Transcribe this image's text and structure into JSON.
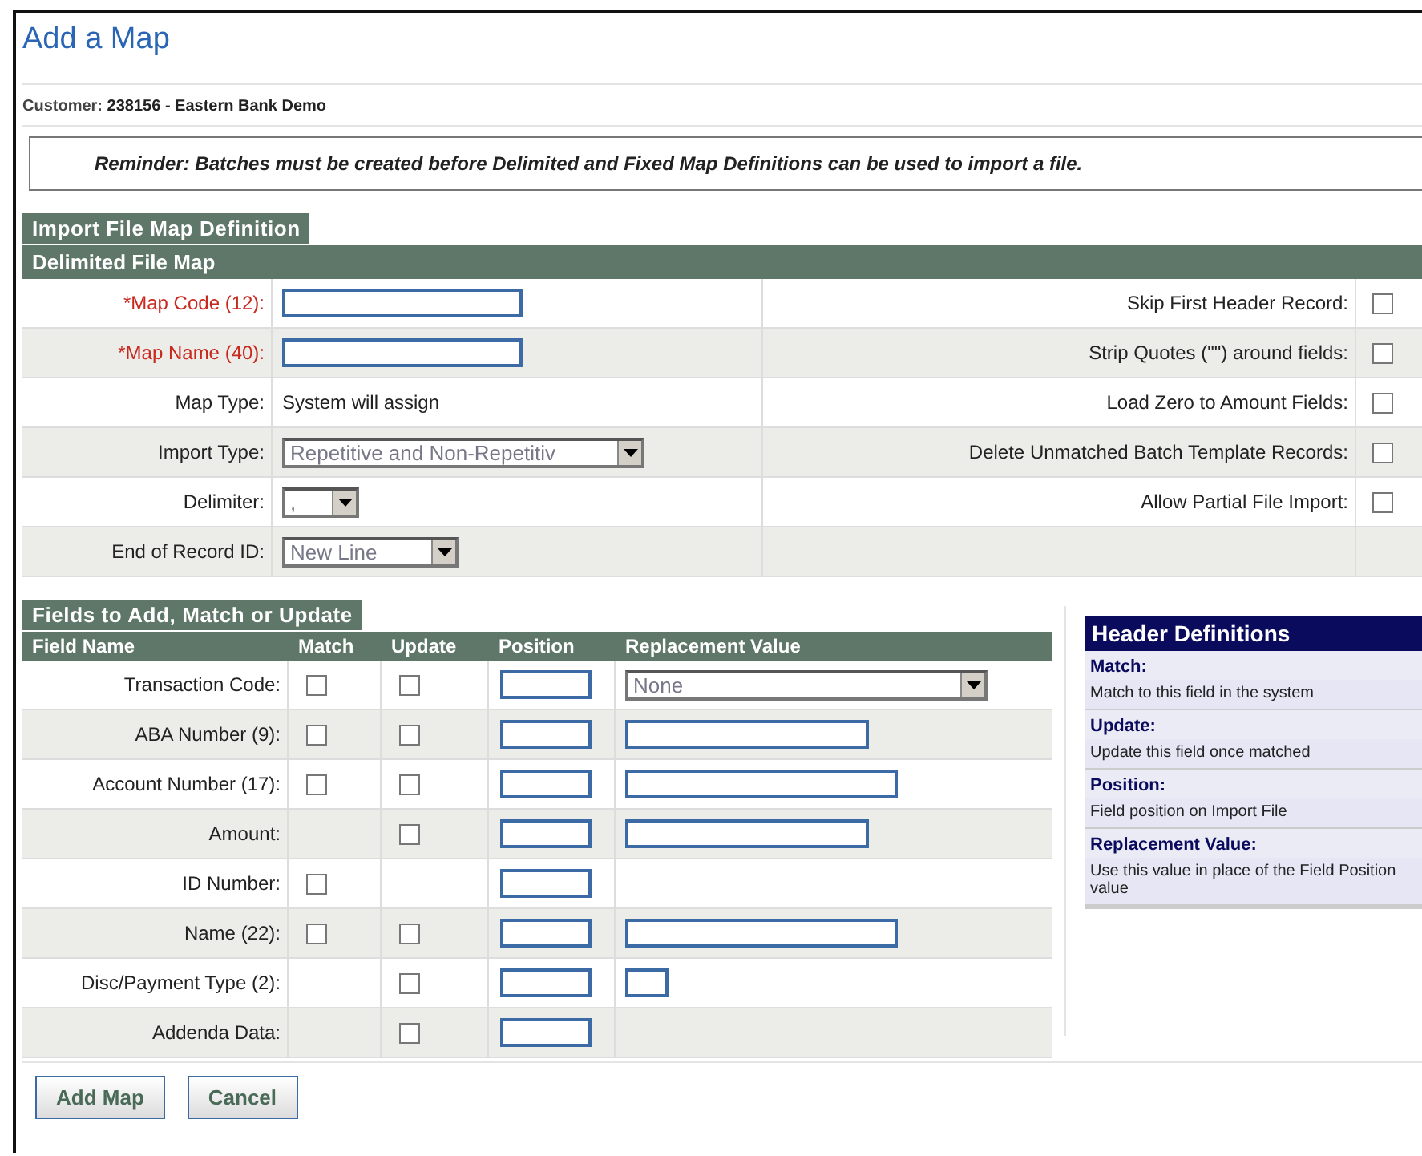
{
  "page_title": "Add a Map",
  "customer": {
    "label": "Customer:",
    "value": "238156 - Eastern Bank Demo"
  },
  "reminder": "Reminder: Batches must be created before Delimited and Fixed Map Definitions can be used to import a file.",
  "section_tab": "Import File Map Definition",
  "map_section": {
    "title": "Delimited File Map",
    "rows": [
      {
        "label": "*Map Code (12):",
        "required": true,
        "kind": "input",
        "value": "",
        "option": "Skip First Header Record:",
        "checked": false
      },
      {
        "label": "*Map Name (40):",
        "required": true,
        "kind": "input",
        "value": "",
        "option": "Strip Quotes (\"\") around fields:",
        "checked": false
      },
      {
        "label": "Map Type:",
        "required": false,
        "kind": "text",
        "value": "System will assign",
        "option": "Load Zero to Amount Fields:",
        "checked": false
      },
      {
        "label": "Import Type:",
        "required": false,
        "kind": "select",
        "value": "Repetitive and Non-Repetitiv",
        "option": "Delete Unmatched Batch Template Records:",
        "checked": false
      },
      {
        "label": "Delimiter:",
        "required": false,
        "kind": "select",
        "value": ",",
        "option": "Allow Partial File Import:",
        "checked": false
      },
      {
        "label": "End of Record ID:",
        "required": false,
        "kind": "select",
        "value": "New Line"
      }
    ]
  },
  "fields_tab": "Fields to Add, Match or Update",
  "fields_table": {
    "columns": [
      "Field Name",
      "Match",
      "Update",
      "Position",
      "Replacement Value"
    ],
    "rows": [
      {
        "name": "Transaction Code:",
        "match": false,
        "update": false,
        "replacement": {
          "kind": "select",
          "value": "None"
        }
      },
      {
        "name": "ABA Number (9):",
        "match": false,
        "update": false,
        "replacement": {
          "kind": "medium"
        }
      },
      {
        "name": "Account Number (17):",
        "match": false,
        "update": false,
        "replacement": {
          "kind": "wide"
        }
      },
      {
        "name": "Amount:",
        "update": false,
        "replacement": {
          "kind": "medium"
        }
      },
      {
        "name": "ID Number:",
        "match": false
      },
      {
        "name": "Name (22):",
        "match": false,
        "update": false,
        "replacement": {
          "kind": "wide"
        }
      },
      {
        "name": "Disc/Payment Type (2):",
        "update": false,
        "replacement": {
          "kind": "tiny"
        }
      },
      {
        "name": "Addenda Data:",
        "update": false
      }
    ]
  },
  "header_definitions": {
    "title": "Header Definitions",
    "items": [
      {
        "term": "Match:",
        "definition": "Match to this field in the system"
      },
      {
        "term": "Update:",
        "definition": "Update this field once matched"
      },
      {
        "term": "Position:",
        "definition": "Field position on Import File"
      },
      {
        "term": "Replacement Value:",
        "definition": "Use this value in place of the Field Position value"
      }
    ]
  },
  "buttons": [
    "Add Map",
    "Cancel"
  ]
}
